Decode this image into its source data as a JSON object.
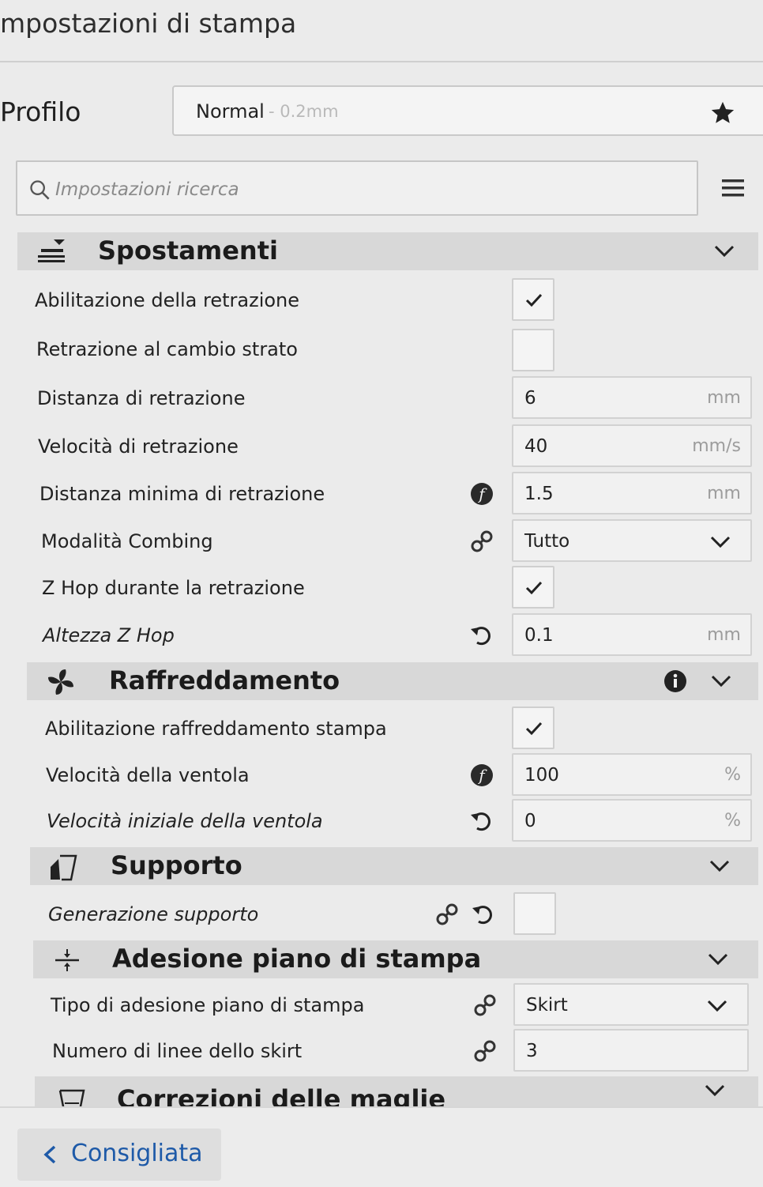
{
  "panel": {
    "title": "mpostazioni di stampa"
  },
  "profile": {
    "label": "Profilo",
    "name": "Normal",
    "detail": "- 0.2mm"
  },
  "search": {
    "placeholder": "Impostazioni ricerca",
    "value": ""
  },
  "sections": [
    {
      "title": "Spostamenti",
      "icon": "travel-icon",
      "rows": [
        {
          "label": "Abilitazione della retrazione",
          "type": "checkbox",
          "checked": true
        },
        {
          "label": "Retrazione al cambio strato",
          "type": "checkbox",
          "checked": false
        },
        {
          "label": "Distanza di retrazione",
          "type": "number",
          "value": "6",
          "unit": "mm"
        },
        {
          "label": "Velocità di retrazione",
          "type": "number",
          "value": "40",
          "unit": "mm/s"
        },
        {
          "label": "Distanza minima di retrazione",
          "type": "number",
          "value": "1.5",
          "unit": "mm",
          "icons": [
            "function-icon"
          ]
        },
        {
          "label": "Modalità Combing",
          "type": "select",
          "value": "Tutto",
          "icons": [
            "link-icon"
          ]
        },
        {
          "label": "Z Hop durante la retrazione",
          "type": "checkbox",
          "checked": true
        },
        {
          "label": "Altezza Z Hop",
          "type": "number",
          "value": "0.1",
          "unit": "mm",
          "icons": [
            "reset-icon"
          ],
          "italic": true
        }
      ]
    },
    {
      "title": "Raffreddamento",
      "icon": "fan-icon",
      "rows": [
        {
          "label": "Abilitazione raffreddamento stampa",
          "type": "checkbox",
          "checked": true
        },
        {
          "label": "Velocità della ventola",
          "type": "number",
          "value": "100",
          "unit": "%",
          "icons": [
            "function-icon"
          ]
        },
        {
          "label": "Velocità iniziale della ventola",
          "type": "number",
          "value": "0",
          "unit": "%",
          "icons": [
            "reset-icon"
          ],
          "italic": true
        }
      ]
    },
    {
      "title": "Supporto",
      "icon": "support-icon",
      "rows": [
        {
          "label": "Generazione supporto",
          "type": "checkbox",
          "checked": false,
          "icons": [
            "link-icon",
            "reset-icon"
          ],
          "italic": true
        }
      ]
    },
    {
      "title": "Adesione piano di stampa",
      "icon": "adhesion-icon",
      "rows": [
        {
          "label": "Tipo di adesione piano di stampa",
          "type": "select",
          "value": "Skirt",
          "icons": [
            "link-icon"
          ]
        },
        {
          "label": "Numero di linee dello skirt",
          "type": "number",
          "value": "3",
          "unit": "",
          "icons": [
            "link-icon"
          ]
        }
      ]
    },
    {
      "title": "Correzioni delle maglie",
      "icon": "mesh-fix-icon",
      "rows": []
    }
  ],
  "footer": {
    "back_label": "Consigliata"
  },
  "colors": {
    "accent": "#1e5aa8",
    "section_bg": "#d8d8d8",
    "panel_bg": "#ebebeb"
  }
}
